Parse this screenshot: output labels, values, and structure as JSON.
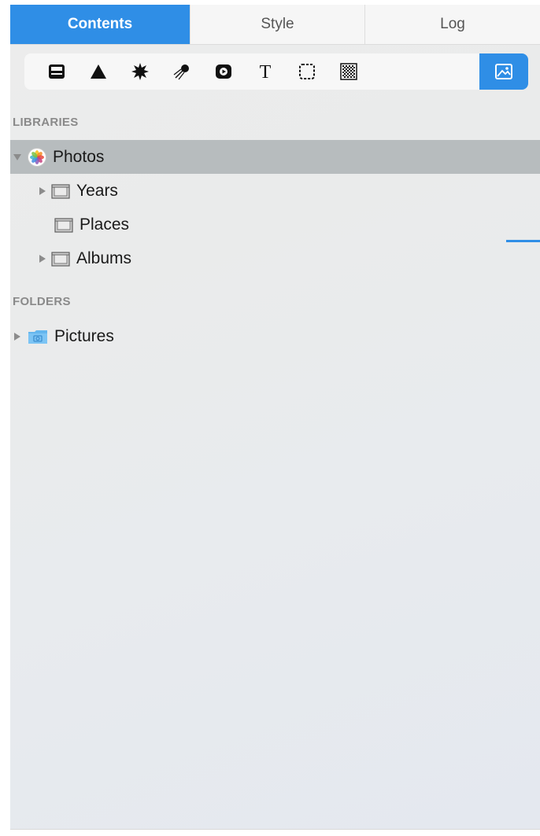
{
  "tabs": [
    {
      "label": "Contents",
      "active": true
    },
    {
      "label": "Style",
      "active": false
    },
    {
      "label": "Log",
      "active": false
    }
  ],
  "toolbar": {
    "tools": [
      {
        "icon": "layout-icon"
      },
      {
        "icon": "triangle-shape-icon"
      },
      {
        "icon": "starburst-icon"
      },
      {
        "icon": "comet-particle-icon"
      },
      {
        "icon": "play-video-icon"
      },
      {
        "icon": "text-icon"
      },
      {
        "icon": "selection-rect-icon"
      },
      {
        "icon": "checkerboard-icon"
      },
      {
        "icon": "image-icon",
        "active": true
      }
    ],
    "accent": "#2f8ee6"
  },
  "sections": {
    "libraries_label": "LIBRARIES",
    "folders_label": "FOLDERS"
  },
  "libraries": {
    "photos": "Photos",
    "years": "Years",
    "places": "Places",
    "albums": "Albums"
  },
  "folders": {
    "pictures": "Pictures"
  },
  "colors": {
    "accent": "#2f8ee6",
    "selected_row": "#b7bcbe"
  }
}
